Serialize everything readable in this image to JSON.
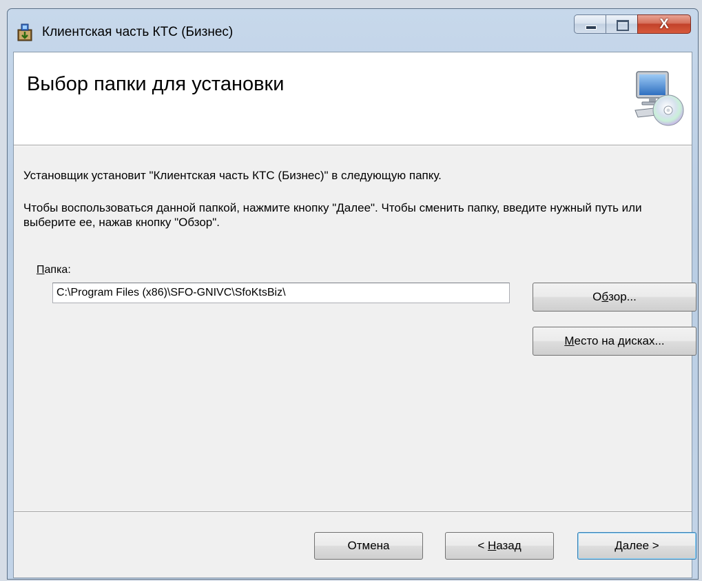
{
  "window": {
    "title": "Клиентская часть КТС (Бизнес)",
    "caption": {
      "minimize": "–",
      "maximize": "□",
      "close": "X"
    }
  },
  "banner": {
    "title": "Выбор папки для установки",
    "icon": "computer-cd-icon"
  },
  "body": {
    "intro": "Установщик установит \"Клиентская часть КТС (Бизнес)\" в следующую папку.",
    "instructions": "Чтобы воспользоваться данной папкой, нажмите кнопку \"Далее\". Чтобы сменить папку, введите нужный путь или выберите ее, нажав кнопку \"Обзор\".",
    "folder_label_access": "П",
    "folder_label_rest": "апка:",
    "folder_path": "C:\\Program Files (x86)\\SFO-GNIVC\\SfoKtsBiz\\",
    "browse_pre": "О",
    "browse_access": "б",
    "browse_post": "зор...",
    "disk_access": "М",
    "disk_post": "есто на дисках..."
  },
  "footer": {
    "cancel": "Отмена",
    "back_pre": "< ",
    "back_access": "Н",
    "back_post": "азад",
    "next": "Далее >"
  }
}
